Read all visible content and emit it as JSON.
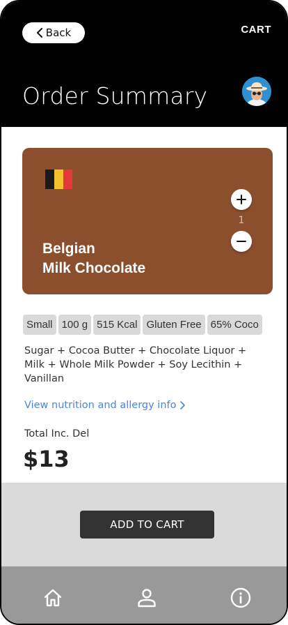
{
  "header": {
    "back_label": "Back",
    "cart_label": "CART",
    "title": "Order Summary",
    "avatar_icon": "user-avatar"
  },
  "product": {
    "name_line1": "Belgian",
    "name_line2": "Milk Chocolate",
    "card_color": "#8b4f2e",
    "flag_icon": "belgium-flag-icon",
    "flag_colors": [
      "#1a1a1a",
      "#f2c12e",
      "#e5383b"
    ],
    "quantity": "1",
    "tags": [
      "Small",
      "100 g",
      "515 Kcal",
      "Gluten Free",
      "65% Coco"
    ],
    "ingredients": "Sugar + Cocoa Butter + Chocolate Liquor + Milk + Whole Milk Powder + Soy Lecithin + Vanillan",
    "nutrition_link": "View nutrition and allergy info",
    "total_label": "Total Inc. Del",
    "total_price": "$13"
  },
  "actions": {
    "add_to_cart_label": "ADD TO CART"
  },
  "tab_bar": {
    "items": [
      {
        "icon": "home-icon"
      },
      {
        "icon": "profile-icon"
      },
      {
        "icon": "info-icon"
      }
    ]
  },
  "colors": {
    "header_bg": "#000000",
    "link": "#4a86d9",
    "button_bg": "#333333",
    "action_area_bg": "#dadada",
    "tab_bar_bg": "#999999"
  }
}
